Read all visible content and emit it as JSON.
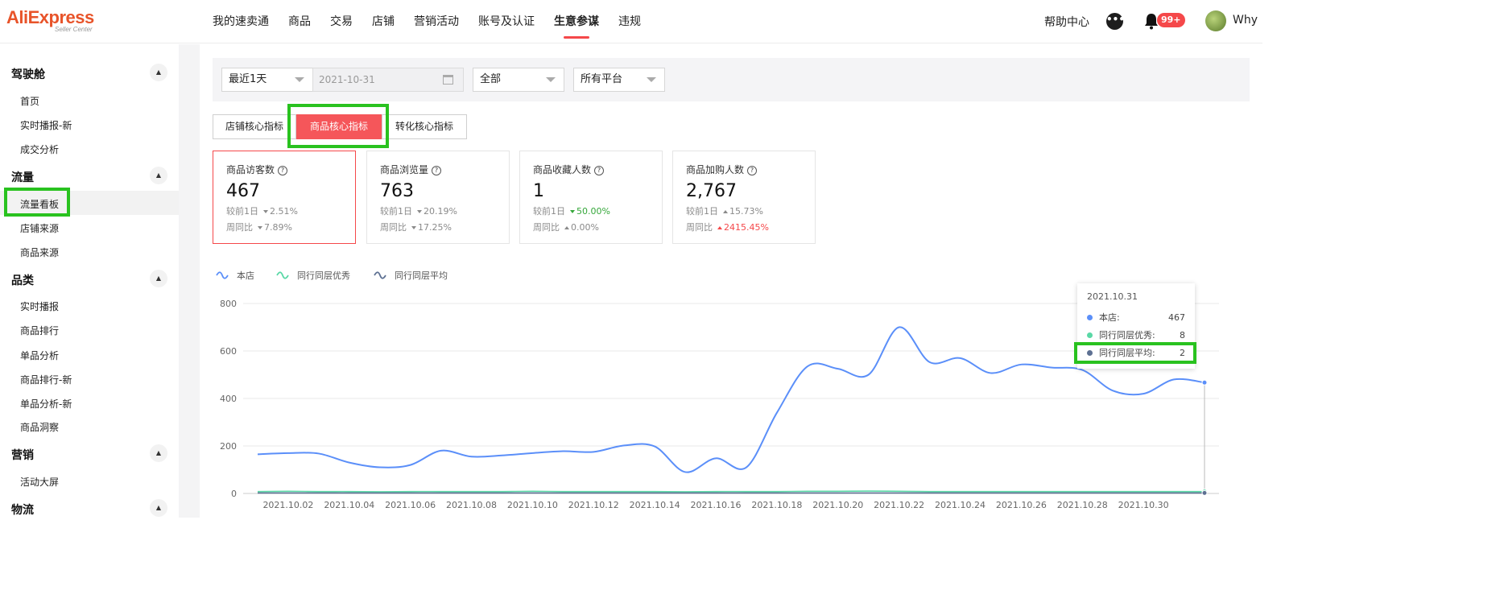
{
  "header": {
    "logo": {
      "brand": "AliExpress",
      "sub": "Seller Center"
    },
    "nav": [
      "我的速卖通",
      "商品",
      "交易",
      "店铺",
      "营销活动",
      "账号及认证",
      "生意参谋",
      "违规"
    ],
    "help": "帮助中心",
    "badge": "99+",
    "username": "Why"
  },
  "sidebar": {
    "groups": [
      {
        "label": "驾驶舱",
        "items": [
          "首页",
          "实时播报-新",
          "成交分析"
        ]
      },
      {
        "label": "流量",
        "items": [
          "流量看板",
          "店铺来源",
          "商品来源"
        ]
      },
      {
        "label": "品类",
        "items": [
          "实时播报",
          "商品排行",
          "单品分析",
          "商品排行-新",
          "单品分析-新",
          "商品洞察"
        ]
      },
      {
        "label": "营销",
        "items": [
          "活动大屏"
        ]
      },
      {
        "label": "物流",
        "items": []
      }
    ],
    "active_item": "流量看板"
  },
  "filters": {
    "period": "最近1天",
    "date": "2021-10-31",
    "scope": "全部",
    "platform": "所有平台"
  },
  "tabs": [
    "店铺核心指标",
    "商品核心指标",
    "转化核心指标"
  ],
  "active_tab": "商品核心指标",
  "cards": [
    {
      "title": "商品访客数",
      "value": "467",
      "prev_day_label": "较前1日",
      "prev_day": "2.51%",
      "prev_day_dir": "down",
      "week_label": "周同比",
      "week": "7.89%",
      "week_dir": "down"
    },
    {
      "title": "商品浏览量",
      "value": "763",
      "prev_day_label": "较前1日",
      "prev_day": "20.19%",
      "prev_day_dir": "down",
      "week_label": "周同比",
      "week": "17.25%",
      "week_dir": "down"
    },
    {
      "title": "商品收藏人数",
      "value": "1",
      "prev_day_label": "较前1日",
      "prev_day": "50.00%",
      "prev_day_dir": "down-green",
      "week_label": "周同比",
      "week": "0.00%",
      "week_dir": "up"
    },
    {
      "title": "商品加购人数",
      "value": "2,767",
      "prev_day_label": "较前1日",
      "prev_day": "15.73%",
      "prev_day_dir": "up",
      "week_label": "周同比",
      "week": "2415.45%",
      "week_dir": "up-red"
    }
  ],
  "colors": {
    "accent": "#f5484a",
    "series_store": "#5b8ff9",
    "series_top": "#5ad8a6",
    "series_avg": "#5d7092",
    "highlight": "#29c21f"
  },
  "chart_data": {
    "type": "line",
    "legend": [
      "本店",
      "同行同层优秀",
      "同行同层平均"
    ],
    "x_ticks": [
      "2021.10.02",
      "2021.10.04",
      "2021.10.06",
      "2021.10.08",
      "2021.10.10",
      "2021.10.12",
      "2021.10.14",
      "2021.10.16",
      "2021.10.18",
      "2021.10.20",
      "2021.10.22",
      "2021.10.24",
      "2021.10.26",
      "2021.10.28",
      "2021.10.30"
    ],
    "y_ticks": [
      0,
      200,
      400,
      600,
      800
    ],
    "ylim": [
      0,
      800
    ],
    "x": [
      "2021.10.01",
      "2021.10.02",
      "2021.10.03",
      "2021.10.04",
      "2021.10.05",
      "2021.10.06",
      "2021.10.07",
      "2021.10.08",
      "2021.10.09",
      "2021.10.10",
      "2021.10.11",
      "2021.10.12",
      "2021.10.13",
      "2021.10.14",
      "2021.10.15",
      "2021.10.16",
      "2021.10.17",
      "2021.10.18",
      "2021.10.19",
      "2021.10.20",
      "2021.10.21",
      "2021.10.22",
      "2021.10.23",
      "2021.10.24",
      "2021.10.25",
      "2021.10.26",
      "2021.10.27",
      "2021.10.28",
      "2021.10.29",
      "2021.10.30",
      "2021.10.31"
    ],
    "series": [
      {
        "name": "本店",
        "values": [
          165,
          170,
          168,
          130,
          110,
          120,
          180,
          155,
          160,
          170,
          178,
          175,
          202,
          198,
          90,
          148,
          110,
          340,
          535,
          525,
          500,
          700,
          553,
          570,
          507,
          543,
          530,
          520,
          433,
          420,
          480,
          467
        ]
      },
      {
        "name": "同行同层优秀",
        "values": [
          8,
          9,
          8,
          8,
          7,
          8,
          8,
          8,
          8,
          9,
          8,
          8,
          8,
          8,
          7,
          8,
          8,
          8,
          9,
          9,
          10,
          9,
          8,
          8,
          8,
          8,
          8,
          8,
          8,
          8,
          8,
          8
        ]
      },
      {
        "name": "同行同层平均",
        "values": [
          2,
          2,
          2,
          2,
          2,
          2,
          2,
          2,
          2,
          2,
          2,
          2,
          2,
          2,
          2,
          2,
          2,
          2,
          2,
          2,
          2,
          2,
          2,
          2,
          2,
          2,
          2,
          2,
          2,
          2,
          2,
          2
        ]
      }
    ],
    "tooltip": {
      "date": "2021.10.31",
      "rows": [
        {
          "name": "本店:",
          "value": "467"
        },
        {
          "name": "同行同层优秀:",
          "value": "8"
        },
        {
          "name": "同行同层平均:",
          "value": "2"
        }
      ]
    }
  }
}
